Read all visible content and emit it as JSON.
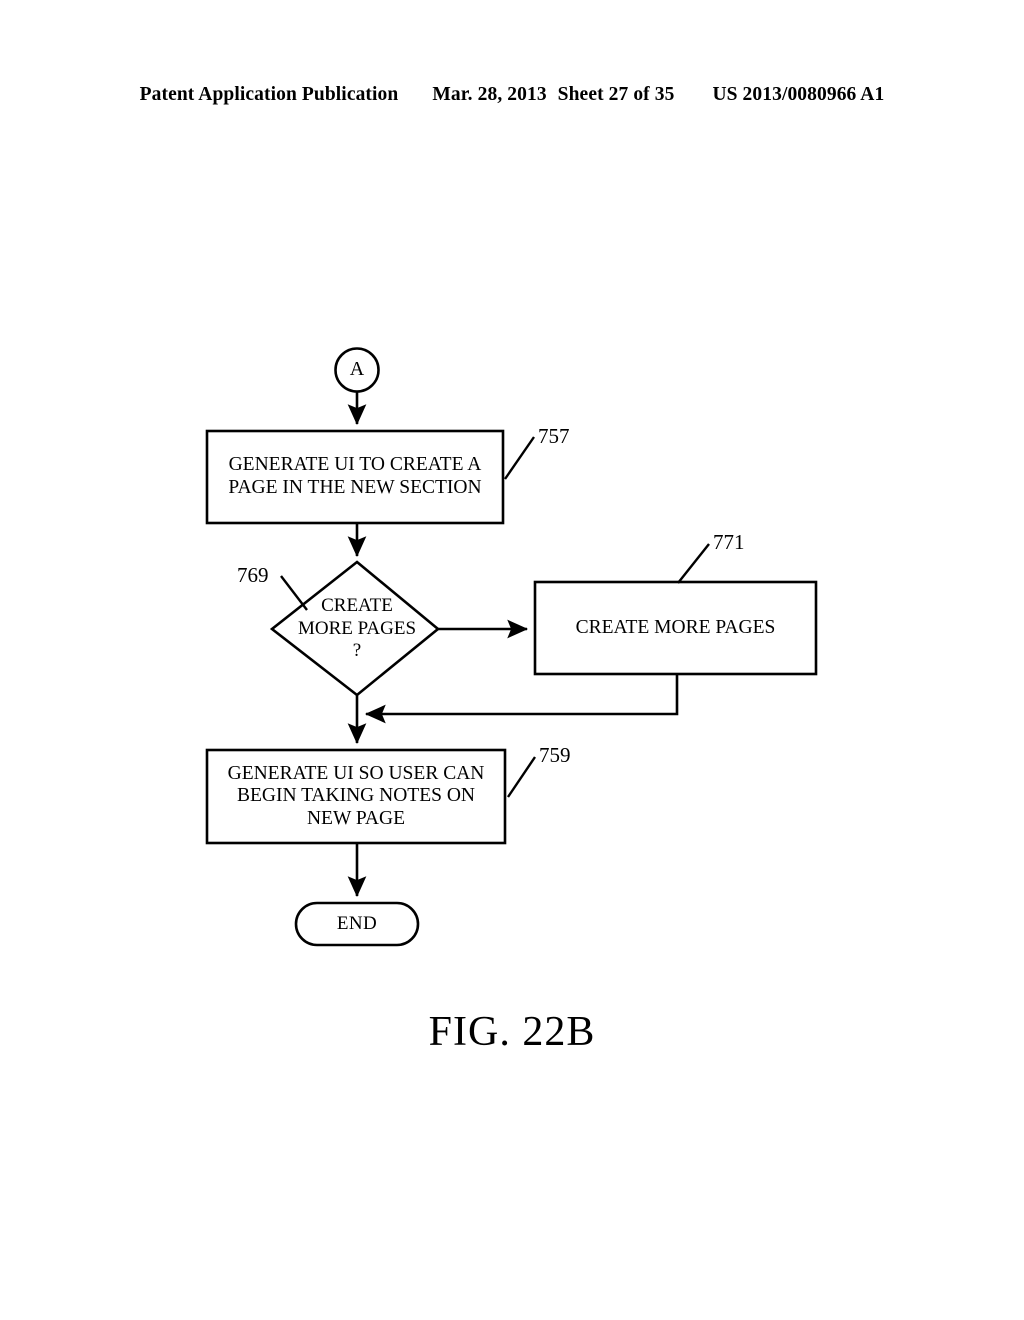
{
  "header": {
    "publication": "Patent Application Publication",
    "date": "Mar. 28, 2013",
    "sheet": "Sheet 27 of 35",
    "patent_number": "US 2013/0080966 A1"
  },
  "figure": {
    "caption": "FIG. 22B",
    "connector_in": {
      "label": "A",
      "shape": "circle"
    },
    "nodes": [
      {
        "ref": "757",
        "shape": "process",
        "lines": [
          "GENERATE UI TO CREATE A",
          "PAGE IN THE NEW SECTION"
        ]
      },
      {
        "ref": "769",
        "shape": "decision",
        "lines": [
          "CREATE",
          "MORE PAGES",
          "?"
        ]
      },
      {
        "ref": "771",
        "shape": "process",
        "lines": [
          "CREATE MORE PAGES"
        ]
      },
      {
        "ref": "759",
        "shape": "process",
        "lines": [
          "GENERATE UI SO USER CAN",
          "BEGIN TAKING NOTES ON",
          "NEW PAGE"
        ]
      }
    ],
    "terminator": {
      "label": "END",
      "shape": "stadium"
    },
    "ref_labels": [
      "757",
      "769",
      "771",
      "759"
    ]
  },
  "style": {
    "ink": "#000000",
    "paper": "#ffffff"
  }
}
